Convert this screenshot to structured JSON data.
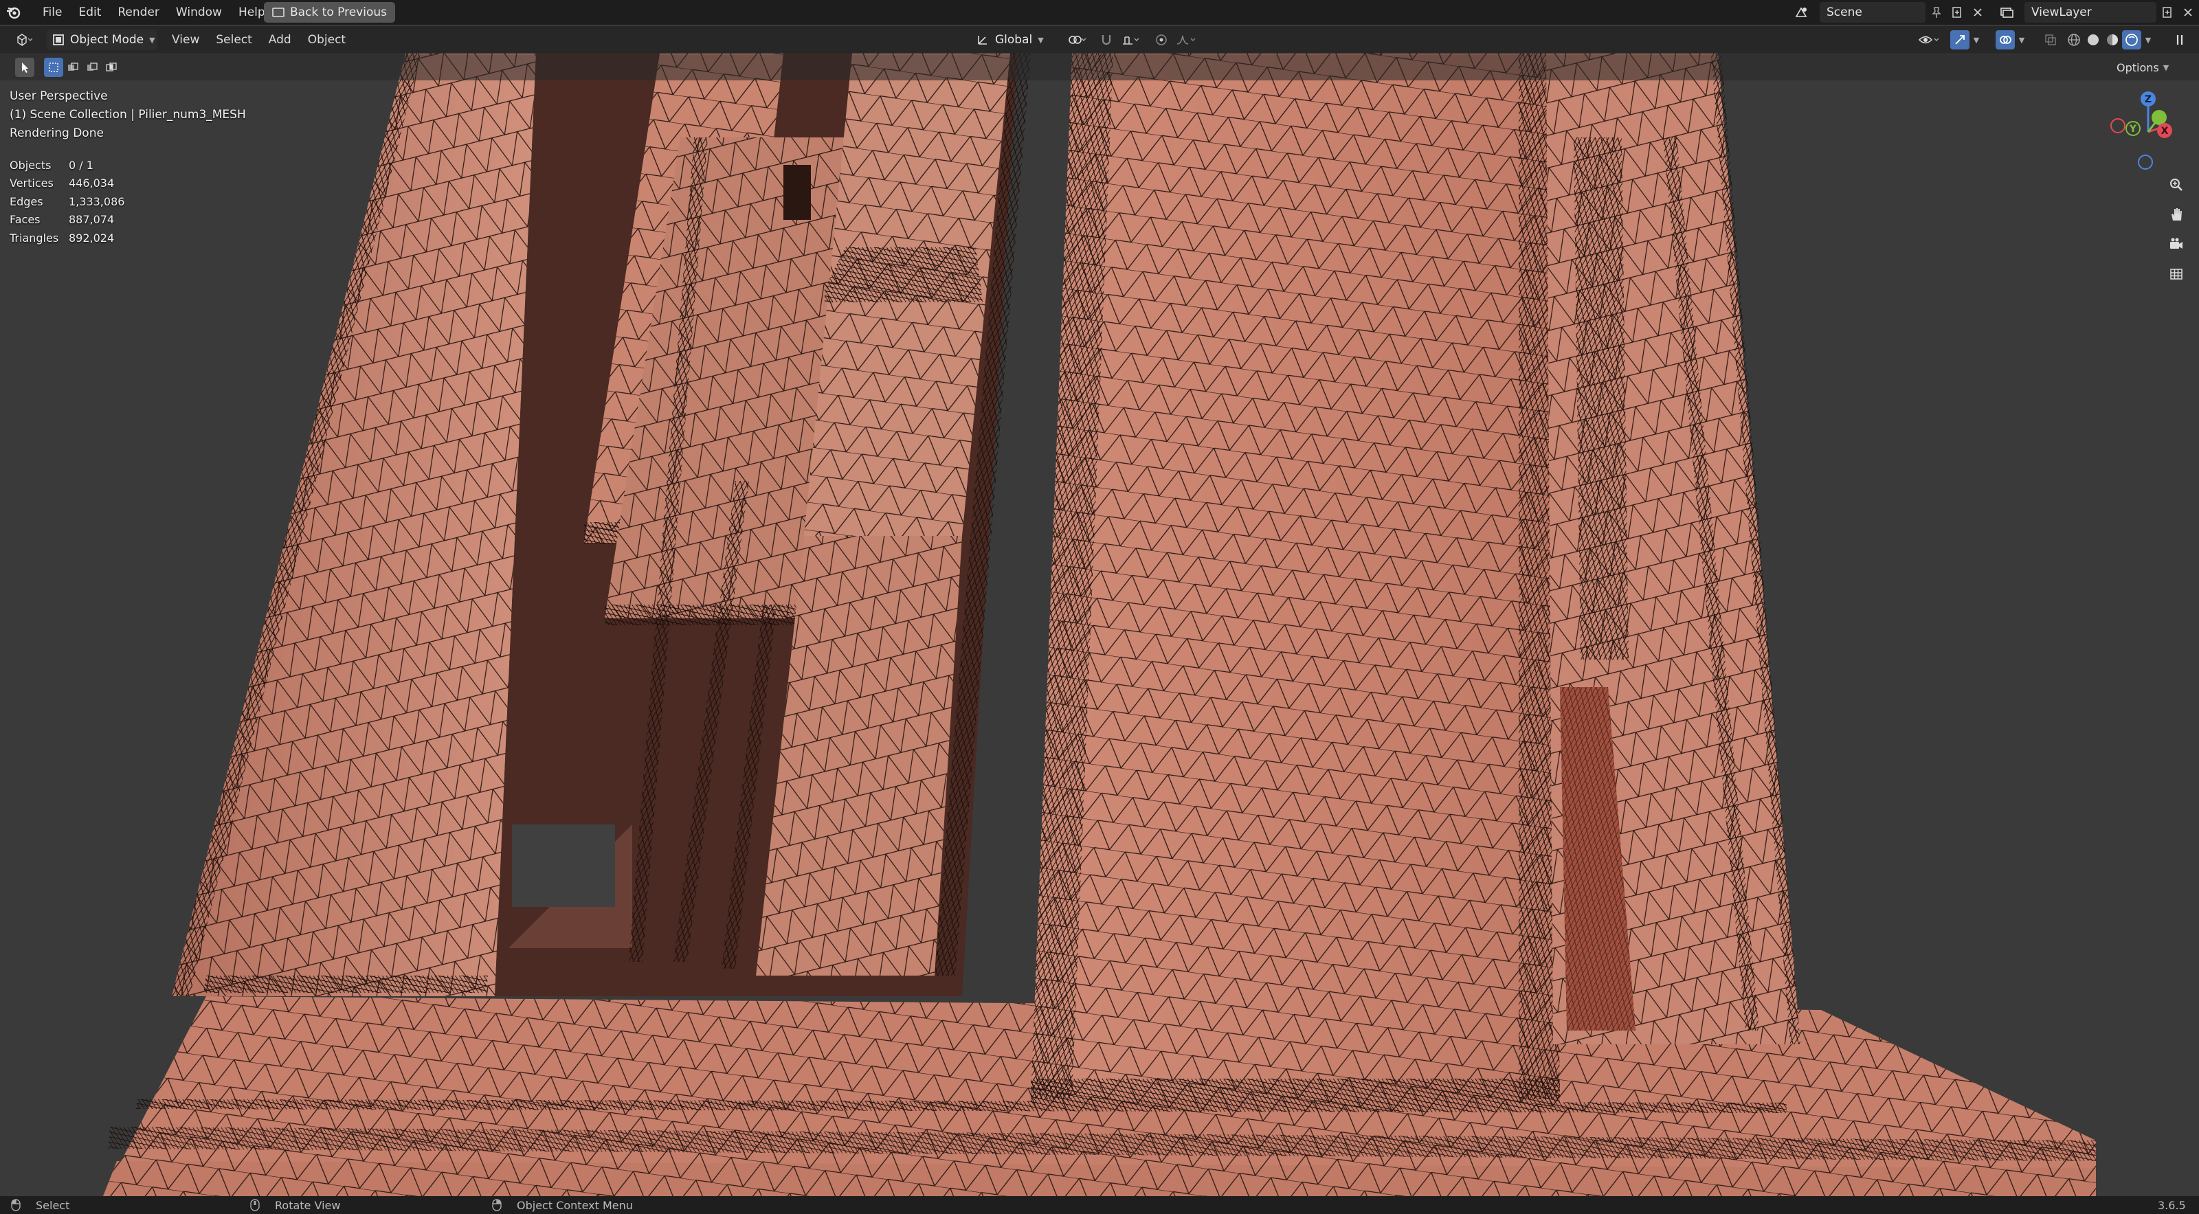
{
  "topbar": {
    "menus": [
      "File",
      "Edit",
      "Render",
      "Window",
      "Help"
    ],
    "back_button": "Back to Previous",
    "scene_value": "Scene",
    "viewlayer_value": "ViewLayer"
  },
  "header": {
    "mode_label": "Object Mode",
    "menus": [
      "View",
      "Select",
      "Add",
      "Object"
    ],
    "transform_orientation": "Global",
    "options_label": "Options"
  },
  "overlay": {
    "view_name": "User Perspective",
    "collection": "(1) Scene Collection | Pilier_num3_MESH",
    "render_status": "Rendering Done"
  },
  "stats": [
    {
      "label": "Objects",
      "value": "0 / 1"
    },
    {
      "label": "Vertices",
      "value": "446,034"
    },
    {
      "label": "Edges",
      "value": "1,333,086"
    },
    {
      "label": "Faces",
      "value": "887,074"
    },
    {
      "label": "Triangles",
      "value": "892,024"
    }
  ],
  "gizmo": {
    "z": "Z",
    "y": "Y",
    "x": "X"
  },
  "statusbar": {
    "select": "Select",
    "rotate": "Rotate View",
    "context": "Object Context Menu",
    "version": "3.6.5"
  },
  "colors": {
    "mesh_fill": "#c9826f",
    "wire": "#2a1712",
    "viewport_bg": "#3a3a3a",
    "accent": "#4772b3",
    "x_axis": "#e04a56",
    "y_axis": "#7fbf3a",
    "z_axis": "#4a86e0"
  },
  "icons": [
    "blender-logo-icon",
    "editor-type-icon",
    "pin-icon",
    "new-scene-icon",
    "close-icon",
    "select-box-icon",
    "zoom-icon",
    "hand-pan-icon",
    "camera-icon",
    "grid-view-icon",
    "mouse-left-icon",
    "mouse-middle-icon",
    "mouse-right-icon"
  ]
}
